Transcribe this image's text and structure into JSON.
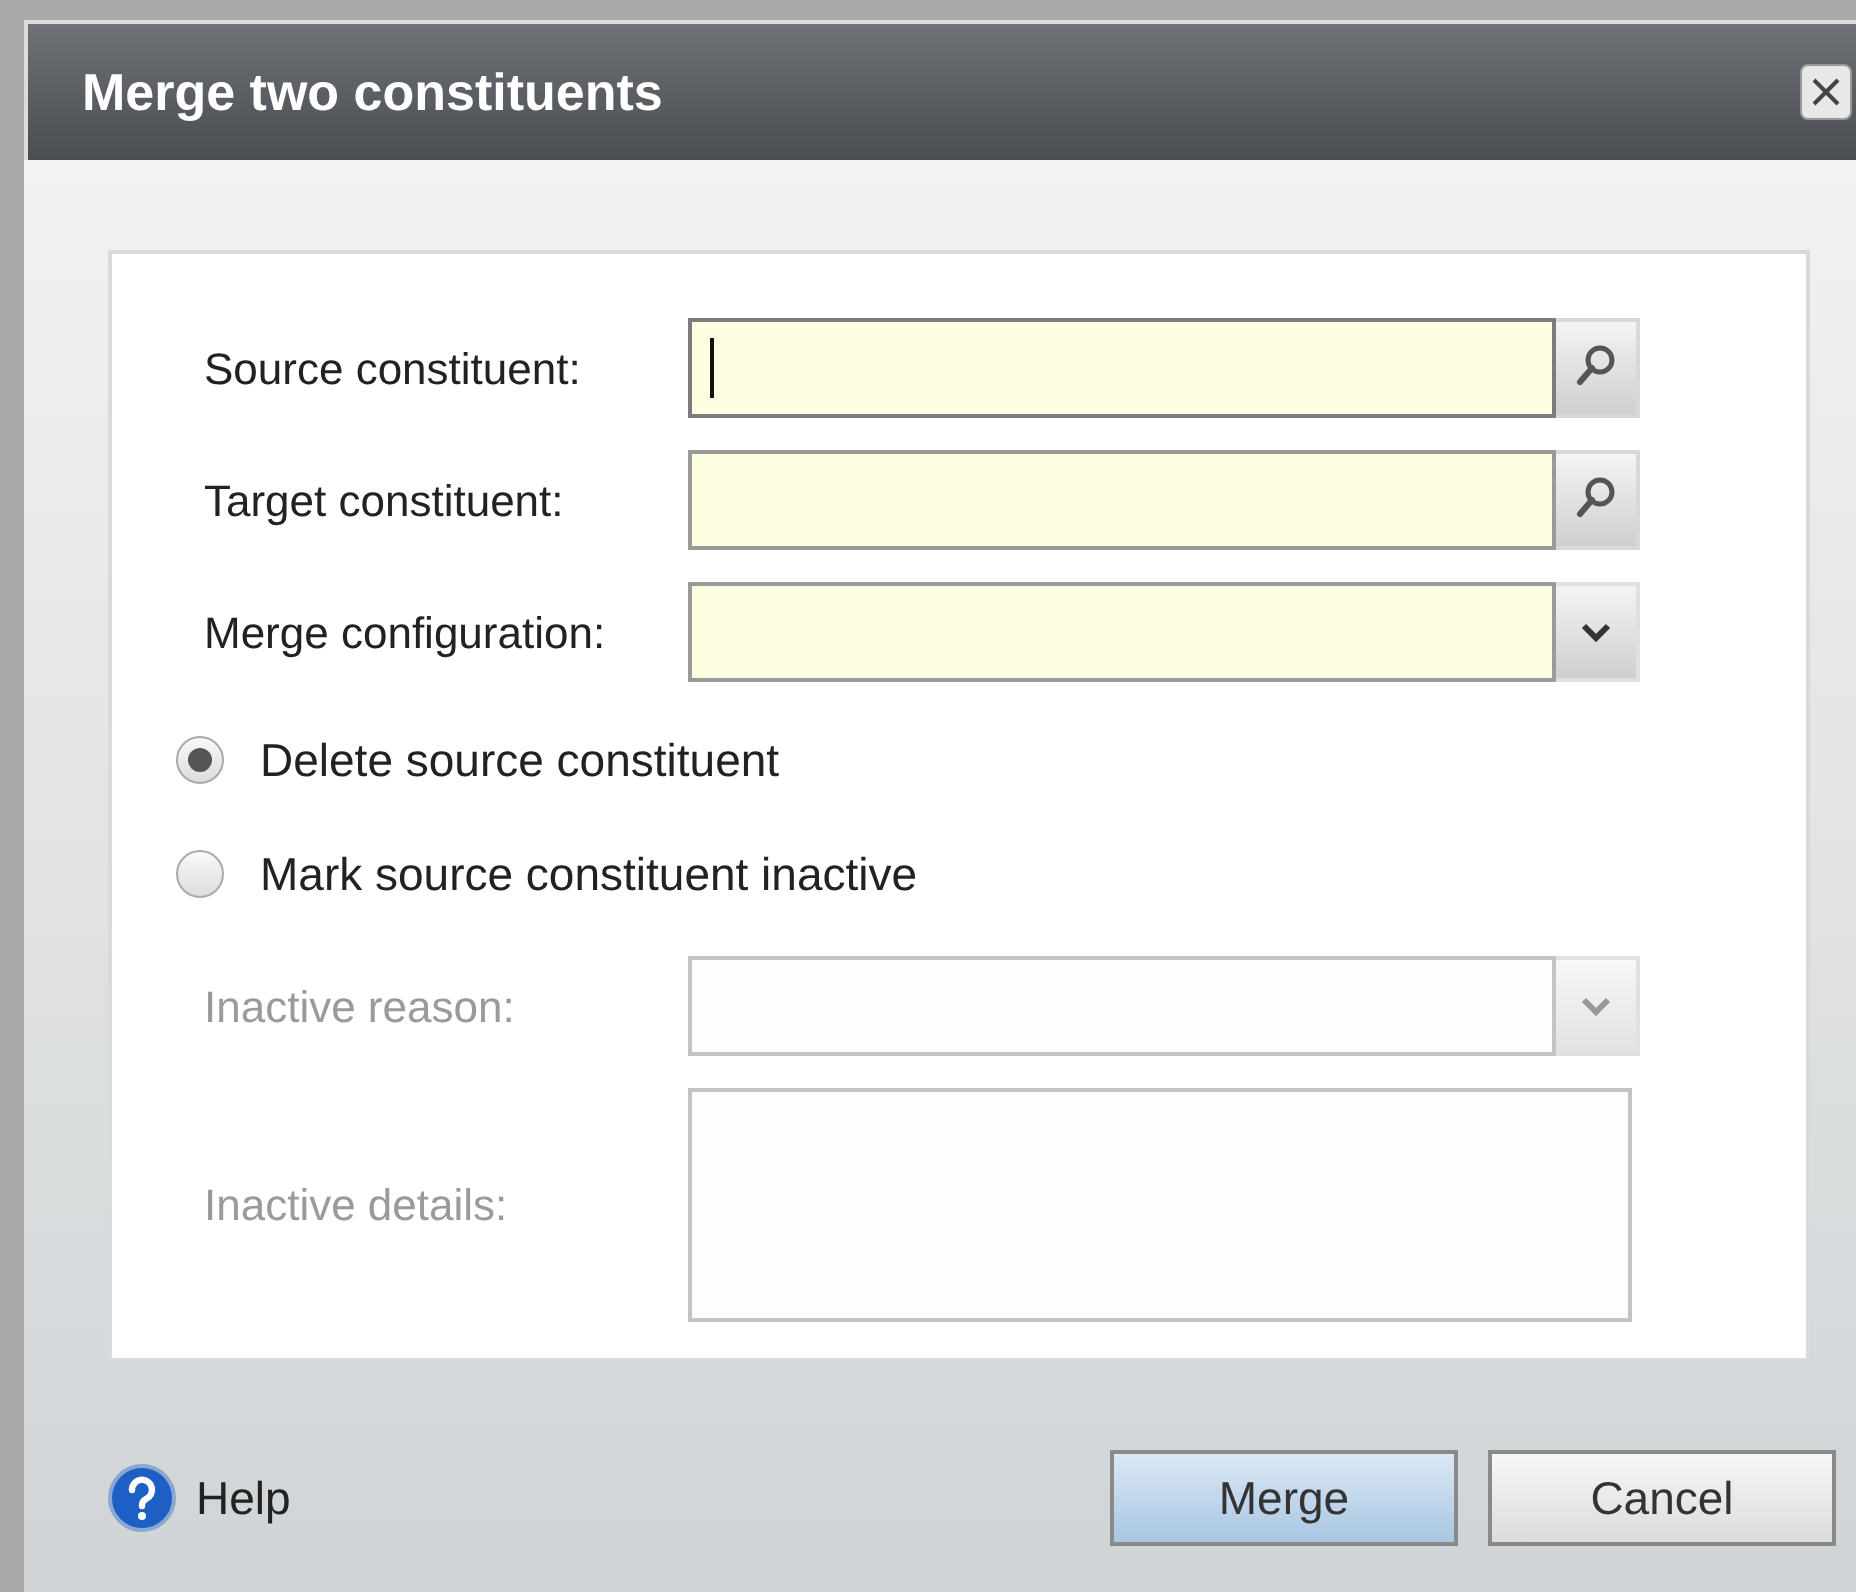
{
  "window": {
    "title": "Merge two constituents"
  },
  "fields": [
    {
      "label": "Source constituent:",
      "kind": "lookup",
      "focused": true,
      "disabled": false
    },
    {
      "label": "Target constituent:",
      "kind": "lookup",
      "focused": false,
      "disabled": false
    },
    {
      "label": "Merge configuration:",
      "kind": "dropdown",
      "focused": false,
      "disabled": false
    }
  ],
  "options": [
    {
      "label": "Delete source constituent",
      "selected": true
    },
    {
      "label": "Mark source constituent inactive",
      "selected": false
    }
  ],
  "inactive_fields": [
    {
      "label": "Inactive reason:",
      "kind": "dropdown",
      "disabled": true
    },
    {
      "label": "Inactive details:",
      "kind": "textarea",
      "disabled": true
    }
  ],
  "help": "Help",
  "buttons": [
    {
      "label": "Merge",
      "kind": "primary"
    },
    {
      "label": "Cancel",
      "kind": "secondary"
    }
  ]
}
